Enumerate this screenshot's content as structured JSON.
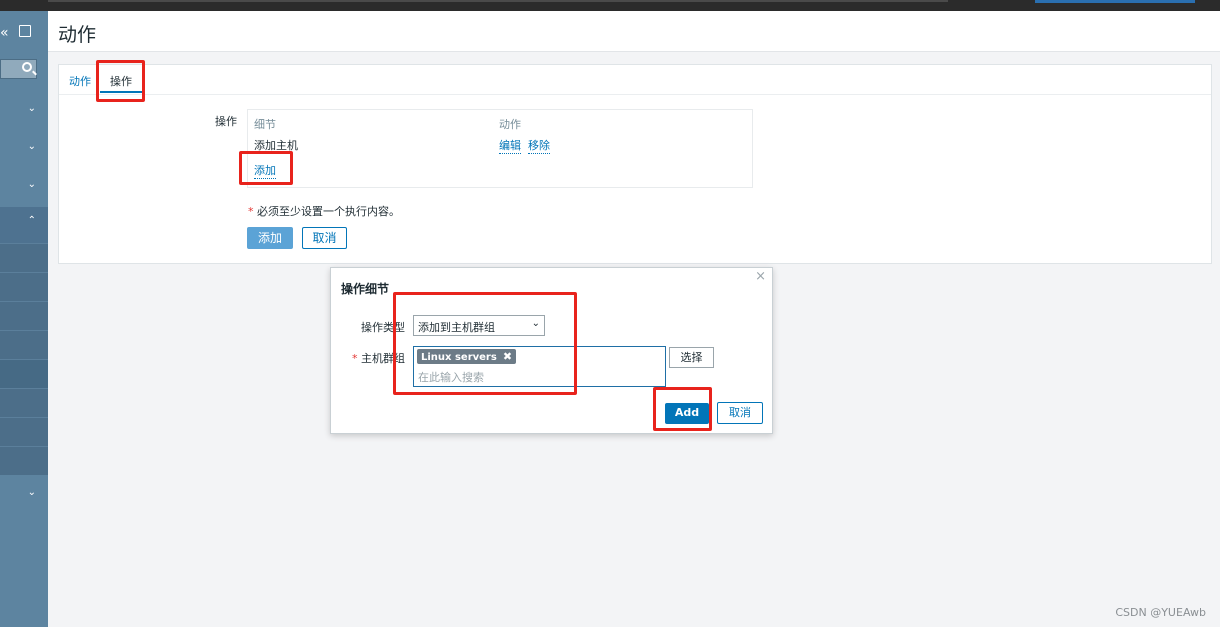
{
  "header": {
    "title": "动作"
  },
  "sidebar": {
    "collapse_glyph": "«",
    "menus": [
      "⌄",
      "⌄",
      "⌄",
      "⌃",
      "⌄"
    ]
  },
  "tabs": [
    {
      "label": "动作",
      "active": false
    },
    {
      "label": "操作",
      "active": true
    }
  ],
  "operations": {
    "label": "操作",
    "col_details": "细节",
    "col_action": "动作",
    "row_detail": "添加主机",
    "edit": "编辑",
    "remove": "移除",
    "add_link": "添加"
  },
  "form": {
    "required_note": "必须至少设置一个执行内容。",
    "add_button": "添加",
    "cancel_button": "取消"
  },
  "dialog": {
    "title": "操作细节",
    "close": "×",
    "type_label": "操作类型",
    "type_value": "添加到主机群组",
    "group_label": "主机群组",
    "tag_label": "Linux servers",
    "tag_remove": "✖",
    "search_placeholder": "在此输入搜索",
    "select_button": "选择",
    "add_button": "Add",
    "cancel_button": "取消"
  },
  "watermark": "CSDN @YUEAwb",
  "colors": {
    "sidebar": "#5d84a0",
    "primary": "#0275b8",
    "highlight": "#e8231c"
  }
}
